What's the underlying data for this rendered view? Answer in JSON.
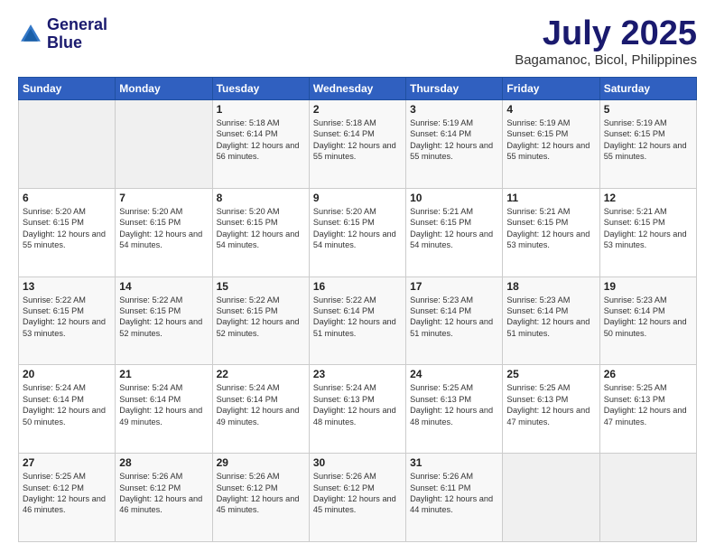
{
  "header": {
    "logo_line1": "General",
    "logo_line2": "Blue",
    "month": "July 2025",
    "location": "Bagamanoc, Bicol, Philippines"
  },
  "days_of_week": [
    "Sunday",
    "Monday",
    "Tuesday",
    "Wednesday",
    "Thursday",
    "Friday",
    "Saturday"
  ],
  "weeks": [
    [
      {
        "day": "",
        "sunrise": "",
        "sunset": "",
        "daylight": ""
      },
      {
        "day": "",
        "sunrise": "",
        "sunset": "",
        "daylight": ""
      },
      {
        "day": "1",
        "sunrise": "Sunrise: 5:18 AM",
        "sunset": "Sunset: 6:14 PM",
        "daylight": "Daylight: 12 hours and 56 minutes."
      },
      {
        "day": "2",
        "sunrise": "Sunrise: 5:18 AM",
        "sunset": "Sunset: 6:14 PM",
        "daylight": "Daylight: 12 hours and 55 minutes."
      },
      {
        "day": "3",
        "sunrise": "Sunrise: 5:19 AM",
        "sunset": "Sunset: 6:14 PM",
        "daylight": "Daylight: 12 hours and 55 minutes."
      },
      {
        "day": "4",
        "sunrise": "Sunrise: 5:19 AM",
        "sunset": "Sunset: 6:15 PM",
        "daylight": "Daylight: 12 hours and 55 minutes."
      },
      {
        "day": "5",
        "sunrise": "Sunrise: 5:19 AM",
        "sunset": "Sunset: 6:15 PM",
        "daylight": "Daylight: 12 hours and 55 minutes."
      }
    ],
    [
      {
        "day": "6",
        "sunrise": "Sunrise: 5:20 AM",
        "sunset": "Sunset: 6:15 PM",
        "daylight": "Daylight: 12 hours and 55 minutes."
      },
      {
        "day": "7",
        "sunrise": "Sunrise: 5:20 AM",
        "sunset": "Sunset: 6:15 PM",
        "daylight": "Daylight: 12 hours and 54 minutes."
      },
      {
        "day": "8",
        "sunrise": "Sunrise: 5:20 AM",
        "sunset": "Sunset: 6:15 PM",
        "daylight": "Daylight: 12 hours and 54 minutes."
      },
      {
        "day": "9",
        "sunrise": "Sunrise: 5:20 AM",
        "sunset": "Sunset: 6:15 PM",
        "daylight": "Daylight: 12 hours and 54 minutes."
      },
      {
        "day": "10",
        "sunrise": "Sunrise: 5:21 AM",
        "sunset": "Sunset: 6:15 PM",
        "daylight": "Daylight: 12 hours and 54 minutes."
      },
      {
        "day": "11",
        "sunrise": "Sunrise: 5:21 AM",
        "sunset": "Sunset: 6:15 PM",
        "daylight": "Daylight: 12 hours and 53 minutes."
      },
      {
        "day": "12",
        "sunrise": "Sunrise: 5:21 AM",
        "sunset": "Sunset: 6:15 PM",
        "daylight": "Daylight: 12 hours and 53 minutes."
      }
    ],
    [
      {
        "day": "13",
        "sunrise": "Sunrise: 5:22 AM",
        "sunset": "Sunset: 6:15 PM",
        "daylight": "Daylight: 12 hours and 53 minutes."
      },
      {
        "day": "14",
        "sunrise": "Sunrise: 5:22 AM",
        "sunset": "Sunset: 6:15 PM",
        "daylight": "Daylight: 12 hours and 52 minutes."
      },
      {
        "day": "15",
        "sunrise": "Sunrise: 5:22 AM",
        "sunset": "Sunset: 6:15 PM",
        "daylight": "Daylight: 12 hours and 52 minutes."
      },
      {
        "day": "16",
        "sunrise": "Sunrise: 5:22 AM",
        "sunset": "Sunset: 6:14 PM",
        "daylight": "Daylight: 12 hours and 51 minutes."
      },
      {
        "day": "17",
        "sunrise": "Sunrise: 5:23 AM",
        "sunset": "Sunset: 6:14 PM",
        "daylight": "Daylight: 12 hours and 51 minutes."
      },
      {
        "day": "18",
        "sunrise": "Sunrise: 5:23 AM",
        "sunset": "Sunset: 6:14 PM",
        "daylight": "Daylight: 12 hours and 51 minutes."
      },
      {
        "day": "19",
        "sunrise": "Sunrise: 5:23 AM",
        "sunset": "Sunset: 6:14 PM",
        "daylight": "Daylight: 12 hours and 50 minutes."
      }
    ],
    [
      {
        "day": "20",
        "sunrise": "Sunrise: 5:24 AM",
        "sunset": "Sunset: 6:14 PM",
        "daylight": "Daylight: 12 hours and 50 minutes."
      },
      {
        "day": "21",
        "sunrise": "Sunrise: 5:24 AM",
        "sunset": "Sunset: 6:14 PM",
        "daylight": "Daylight: 12 hours and 49 minutes."
      },
      {
        "day": "22",
        "sunrise": "Sunrise: 5:24 AM",
        "sunset": "Sunset: 6:14 PM",
        "daylight": "Daylight: 12 hours and 49 minutes."
      },
      {
        "day": "23",
        "sunrise": "Sunrise: 5:24 AM",
        "sunset": "Sunset: 6:13 PM",
        "daylight": "Daylight: 12 hours and 48 minutes."
      },
      {
        "day": "24",
        "sunrise": "Sunrise: 5:25 AM",
        "sunset": "Sunset: 6:13 PM",
        "daylight": "Daylight: 12 hours and 48 minutes."
      },
      {
        "day": "25",
        "sunrise": "Sunrise: 5:25 AM",
        "sunset": "Sunset: 6:13 PM",
        "daylight": "Daylight: 12 hours and 47 minutes."
      },
      {
        "day": "26",
        "sunrise": "Sunrise: 5:25 AM",
        "sunset": "Sunset: 6:13 PM",
        "daylight": "Daylight: 12 hours and 47 minutes."
      }
    ],
    [
      {
        "day": "27",
        "sunrise": "Sunrise: 5:25 AM",
        "sunset": "Sunset: 6:12 PM",
        "daylight": "Daylight: 12 hours and 46 minutes."
      },
      {
        "day": "28",
        "sunrise": "Sunrise: 5:26 AM",
        "sunset": "Sunset: 6:12 PM",
        "daylight": "Daylight: 12 hours and 46 minutes."
      },
      {
        "day": "29",
        "sunrise": "Sunrise: 5:26 AM",
        "sunset": "Sunset: 6:12 PM",
        "daylight": "Daylight: 12 hours and 45 minutes."
      },
      {
        "day": "30",
        "sunrise": "Sunrise: 5:26 AM",
        "sunset": "Sunset: 6:12 PM",
        "daylight": "Daylight: 12 hours and 45 minutes."
      },
      {
        "day": "31",
        "sunrise": "Sunrise: 5:26 AM",
        "sunset": "Sunset: 6:11 PM",
        "daylight": "Daylight: 12 hours and 44 minutes."
      },
      {
        "day": "",
        "sunrise": "",
        "sunset": "",
        "daylight": ""
      },
      {
        "day": "",
        "sunrise": "",
        "sunset": "",
        "daylight": ""
      }
    ]
  ]
}
